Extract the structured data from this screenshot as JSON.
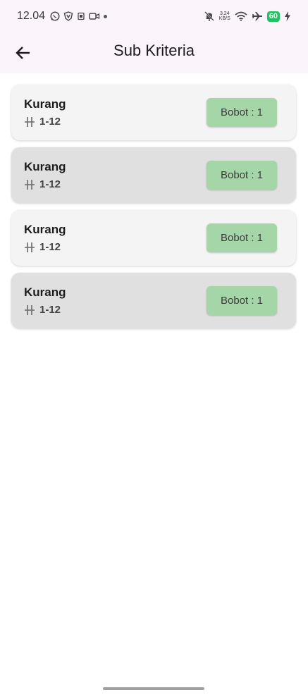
{
  "status_bar": {
    "time": "12.04",
    "net_speed_value": "3,24",
    "net_speed_unit": "KB/S",
    "battery": "60",
    "left_icons": [
      "whatsapp-icon",
      "vpn-shield-icon",
      "sim-icon",
      "video-icon"
    ],
    "right_icons": [
      "bell-off-icon",
      "wifi-icon",
      "airplane-icon",
      "battery-icon",
      "charging-bolt-icon"
    ]
  },
  "app_bar": {
    "title": "Sub Kriteria",
    "back_icon": "arrow-back-icon"
  },
  "items": [
    {
      "title": "Kurang",
      "range": "1-12",
      "bobot": "Bobot : 1",
      "shade": "light"
    },
    {
      "title": "Kurang",
      "range": "1-12",
      "bobot": "Bobot : 1",
      "shade": "dark"
    },
    {
      "title": "Kurang",
      "range": "1-12",
      "bobot": "Bobot : 1",
      "shade": "light"
    },
    {
      "title": "Kurang",
      "range": "1-12",
      "bobot": "Bobot : 1",
      "shade": "dark"
    }
  ],
  "colors": {
    "app_bar_bg": "#fcf4fb",
    "card_light": "#f4f4f4",
    "card_dark": "#e0e0e0",
    "badge_bg": "#a5d6a7",
    "battery": "#22c25f"
  }
}
